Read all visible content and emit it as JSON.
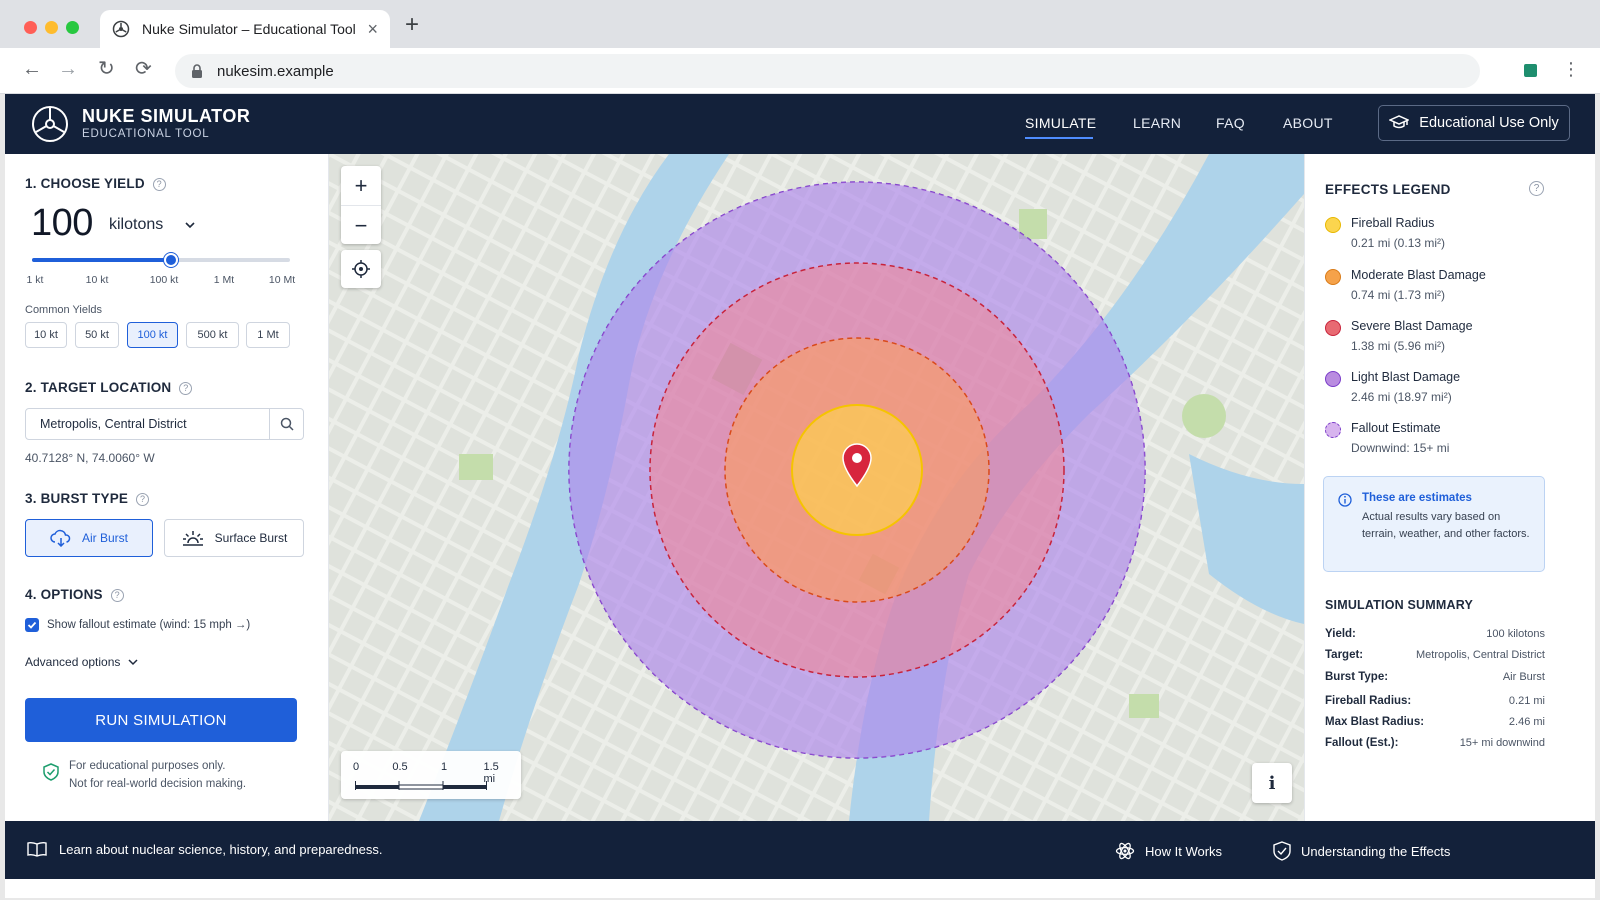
{
  "browser": {
    "tab_title": "Nuke Simulator – Educational Tool",
    "url": "nukesim.example"
  },
  "header": {
    "brand_name": "NUKE SIMULATOR",
    "brand_sub": "EDUCATIONAL TOOL",
    "nav": [
      "SIMULATE",
      "LEARN",
      "FAQ",
      "ABOUT"
    ],
    "active_nav": "SIMULATE",
    "edu_button": "Educational Use Only"
  },
  "controls": {
    "yield_title": "1. CHOOSE YIELD",
    "yield_value": "100",
    "yield_unit": "kilotons",
    "slider_position_fraction": 0.54,
    "slider_ticks": [
      "1 kt",
      "10 kt",
      "100 kt",
      "1 Mt",
      "10 Mt"
    ],
    "common_label": "Common Yields",
    "common_yields": [
      "10 kt",
      "50 kt",
      "100 kt",
      "500 kt",
      "1 Mt"
    ],
    "active_common_yield": "100 kt",
    "location_title": "2. TARGET LOCATION",
    "location_value": "Metropolis, Central District",
    "coords": "40.7128° N, 74.0060° W",
    "burst_title": "3. BURST TYPE",
    "burst_air": "Air Burst",
    "burst_surface": "Surface Burst",
    "active_burst": "Air Burst",
    "options_title": "4. OPTIONS",
    "fallout_option": "Show fallout estimate (wind: 15 mph →)",
    "fallout_checked": true,
    "advanced": "Advanced options",
    "run_button": "RUN SIMULATION",
    "disclaimer_line1": "For educational purposes only.",
    "disclaimer_line2": "Not for real-world decision making."
  },
  "map": {
    "scale_labels": [
      "0",
      "0.5",
      "1",
      "1.5 mi"
    ],
    "info_button": "i"
  },
  "legend": {
    "title": "EFFECTS LEGEND",
    "items": [
      {
        "name": "Fireball Radius",
        "value": "0.21 mi (0.13 mi²)",
        "color": "#fbd54e"
      },
      {
        "name": "Moderate Blast Damage",
        "value": "0.74 mi (1.73 mi²)",
        "color": "#f5a24a"
      },
      {
        "name": "Severe Blast Damage",
        "value": "1.38 mi (5.96 mi²)",
        "color": "#e86a72"
      },
      {
        "name": "Light Blast Damage",
        "value": "2.46 mi (18.97 mi²)",
        "color": "#b98ce0"
      },
      {
        "name": "Fallout Estimate",
        "value": "Downwind: 15+ mi",
        "color": "#d7b4ee"
      }
    ],
    "estimate_title": "These are estimates",
    "estimate_body": "Actual results vary based on terrain, weather, and other factors."
  },
  "summary": {
    "title": "SIMULATION SUMMARY",
    "rows": [
      {
        "k": "Yield:",
        "v": "100 kilotons"
      },
      {
        "k": "Target:",
        "v": "Metropolis, Central District"
      },
      {
        "k": "Burst Type:",
        "v": "Air Burst"
      },
      {
        "k": "Fireball Radius:",
        "v": "0.21 mi"
      },
      {
        "k": "Max Blast Radius:",
        "v": "2.46 mi"
      },
      {
        "k": "Fallout (Est.):",
        "v": "15+ mi downwind"
      }
    ]
  },
  "footer": {
    "left_text": "Learn about nuclear science, history, and preparedness.",
    "how_it_works": "How It Works",
    "understanding": "Understanding the Effects"
  },
  "colors": {
    "accent": "#1f5fd9",
    "header_bg": "#13213a"
  }
}
